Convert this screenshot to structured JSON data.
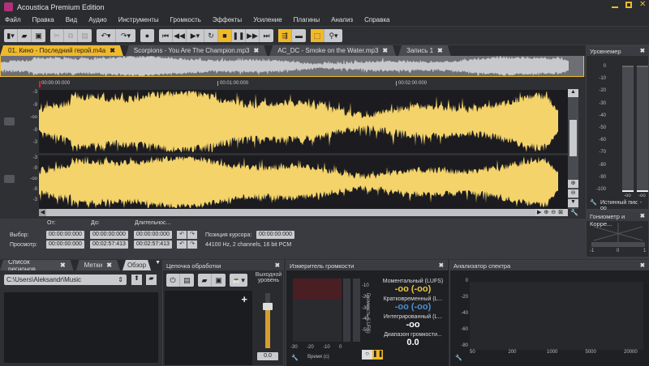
{
  "app": {
    "title": "Acoustica Premium Edition"
  },
  "menu": [
    "Файл",
    "Правка",
    "Вид",
    "Аудио",
    "Инструменты",
    "Громкость",
    "Эффекты",
    "Усиление",
    "Плагины",
    "Анализ",
    "Справка"
  ],
  "tabs": [
    {
      "label": "01. Кино - Последний герой.m4a",
      "active": true
    },
    {
      "label": "Scorpions - You Are The Champion.mp3"
    },
    {
      "label": "AC_DC - Smoke on the Water.mp3"
    },
    {
      "label": "Запись 1"
    }
  ],
  "ruler": [
    "00:00:00:000",
    "00:01:00:000",
    "00:02:00:000"
  ],
  "scale": [
    "-3",
    "-9",
    "-oo",
    "-9",
    "-3"
  ],
  "selection": {
    "from_label": "От:",
    "to_label": "До:",
    "duration_label": "Длительнос...",
    "selection_label": "Выбор:",
    "view_label": "Просмотр:",
    "sel_from": "00:00:00:000",
    "sel_to": "00:00:00:000",
    "sel_dur": "00:00:00:000",
    "view_from": "00:00:00:000",
    "view_to": "00:02:57:413",
    "view_dur": "00:02:57:413",
    "cursor_label": "Позиция курсора:",
    "cursor": "00:00:00:000",
    "format": "44100 Hz, 2 channels, 16 bit PCM"
  },
  "meter": {
    "title": "Уровнемер",
    "ticks": [
      "0",
      "-10",
      "-20",
      "-30",
      "-40",
      "-50",
      "-60",
      "-70",
      "-80",
      "-90",
      "-100"
    ],
    "left": "-oo",
    "right": "-oo",
    "true_peak": "Истинный пик: -oo"
  },
  "gonio": {
    "title": "Гониометр и Корре...",
    "ticks": [
      "-1",
      "0",
      "1"
    ]
  },
  "browser": {
    "tabs": [
      "Список регионов",
      "Метки",
      "Обзор"
    ],
    "path": "C:\\Users\\Aleksandr\\Music"
  },
  "chain": {
    "title": "Цепочка обработки",
    "output_label": "Выходной уровень",
    "output_value": "0.0",
    "output_level": 0.75
  },
  "loudness": {
    "title": "Измеритель громкости",
    "yticks": [
      "-10",
      "-20",
      "-30",
      "-40",
      "-50"
    ],
    "ylabel": "Громкость (LUFS)",
    "xticks": [
      "-30",
      "-20",
      "-10",
      "0"
    ],
    "xlabel": "Время (с)",
    "momentary_label": "Моментальный (LUFS)",
    "momentary": "-oo (-oo)",
    "short_label": "Кратковременный (L...",
    "short": "-oo (-oo)",
    "integrated_label": "Интегрированный (L...",
    "integrated": "-oo",
    "range_label": "Диапазон громкости...",
    "range": "0.0"
  },
  "spectrum": {
    "title": "Анализатор спектра",
    "yticks": [
      "0",
      "-20",
      "-40",
      "-60",
      "-80"
    ],
    "xticks": [
      "50",
      "200",
      "1000",
      "5000",
      "20000"
    ]
  },
  "colors": {
    "accent": "#f0b92b",
    "wave": "#f3d36a"
  }
}
